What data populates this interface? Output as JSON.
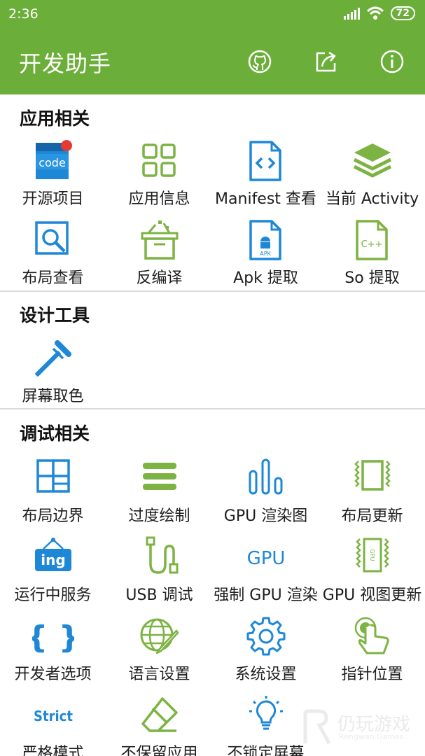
{
  "status_bar": {
    "time": "2:36",
    "battery": "72"
  },
  "app_bar": {
    "title": "开发助手",
    "actions": [
      "github-icon",
      "share-icon",
      "info-icon"
    ]
  },
  "colors": {
    "primary": "#6cae3a",
    "icon_blue": "#1e88d6",
    "icon_green": "#7cb342",
    "badge_red": "#e53935"
  },
  "sections": [
    {
      "title": "应用相关",
      "items": [
        {
          "label": "开源项目",
          "icon": "code-icon",
          "icon_text": "code"
        },
        {
          "label": "应用信息",
          "icon": "app-grid-icon"
        },
        {
          "label": "Manifest 查看",
          "icon": "xml-file-icon"
        },
        {
          "label": "当前 Activity",
          "icon": "layers-icon"
        },
        {
          "label": "布局查看",
          "icon": "magnify-icon"
        },
        {
          "label": "反编译",
          "icon": "box-icon"
        },
        {
          "label": "Apk 提取",
          "icon": "apk-file-icon",
          "icon_text": "APK"
        },
        {
          "label": "So 提取",
          "icon": "cpp-file-icon",
          "icon_text": "C++"
        }
      ]
    },
    {
      "title": "设计工具",
      "items": [
        {
          "label": "屏幕取色",
          "icon": "eyedropper-icon"
        }
      ]
    },
    {
      "title": "调试相关",
      "items": [
        {
          "label": "布局边界",
          "icon": "layout-bounds-icon"
        },
        {
          "label": "过度绘制",
          "icon": "overdraw-icon"
        },
        {
          "label": "GPU 渲染图",
          "icon": "bar-chart-icon"
        },
        {
          "label": "布局更新",
          "icon": "layout-update-icon"
        },
        {
          "label": "运行中服务",
          "icon": "service-sign-icon",
          "icon_text": "ing"
        },
        {
          "label": "USB 调试",
          "icon": "usb-icon"
        },
        {
          "label": "强制 GPU 渲染",
          "icon": "gpu-text-icon",
          "icon_text": "GPU"
        },
        {
          "label": "GPU 视图更新",
          "icon": "gpu-update-icon",
          "icon_text": "GPU"
        },
        {
          "label": "开发者选项",
          "icon": "braces-icon",
          "icon_text": "{ }"
        },
        {
          "label": "语言设置",
          "icon": "globe-pen-icon"
        },
        {
          "label": "系统设置",
          "icon": "gear-icon"
        },
        {
          "label": "指针位置",
          "icon": "pointer-touch-icon"
        },
        {
          "label": "严格模式",
          "icon": "strict-text-icon",
          "icon_text": "Strict"
        },
        {
          "label": "不保留应用",
          "icon": "eraser-icon"
        },
        {
          "label": "不锁定屏幕",
          "icon": "lightbulb-icon"
        }
      ]
    }
  ],
  "watermark": {
    "main": "仍玩游戏",
    "sub": "Rengwan Games"
  }
}
